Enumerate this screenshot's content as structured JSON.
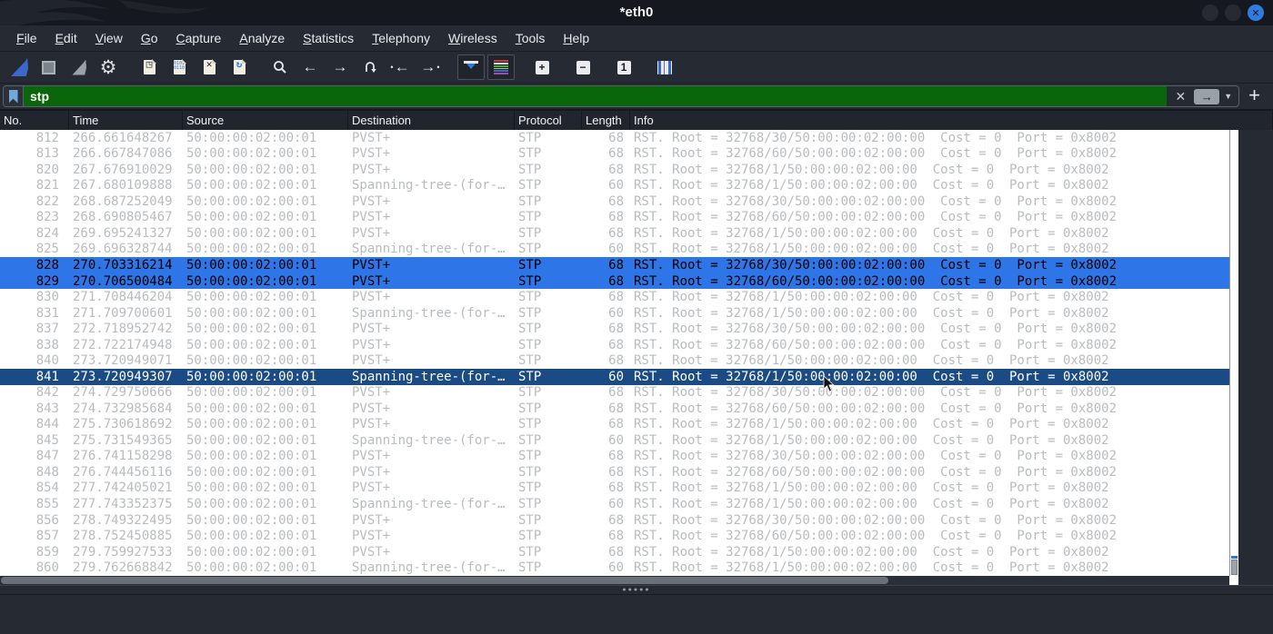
{
  "window": {
    "title": "*eth0"
  },
  "menu": {
    "items": [
      "File",
      "Edit",
      "View",
      "Go",
      "Capture",
      "Analyze",
      "Statistics",
      "Telephony",
      "Wireless",
      "Tools",
      "Help"
    ]
  },
  "toolbar": {
    "buttons": [
      "start-capture",
      "stop-capture",
      "restart-capture",
      "capture-options",
      "open-file",
      "save-file",
      "close-file",
      "reload-file",
      "find-packet",
      "go-back",
      "go-forward",
      "go-to-packet",
      "go-first-packet",
      "go-last-packet",
      "auto-scroll",
      "colorize",
      "zoom-in",
      "zoom-out",
      "normal-size",
      "resize-columns"
    ]
  },
  "filter": {
    "value": "stp"
  },
  "colors": {
    "filter_valid_bg": "#0a660a",
    "selected_row_bg": "#2e76e8",
    "focused_row_bg": "#1b4b84",
    "close_button": "#2f7ce0",
    "row_text": "#b9bcbf"
  },
  "packet_list": {
    "columns": [
      "No.",
      "Time",
      "Source",
      "Destination",
      "Protocol",
      "Length",
      "Info"
    ],
    "packets": [
      {
        "no": "812",
        "time": "266.661648267",
        "source": "50:00:00:02:00:01",
        "destination": "PVST+",
        "protocol": "STP",
        "length": "68",
        "info": "RST. Root = 32768/30/50:00:00:02:00:00  Cost = 0  Port = 0x8002",
        "state": "normal"
      },
      {
        "no": "813",
        "time": "266.667847086",
        "source": "50:00:00:02:00:01",
        "destination": "PVST+",
        "protocol": "STP",
        "length": "68",
        "info": "RST. Root = 32768/60/50:00:00:02:00:00  Cost = 0  Port = 0x8002",
        "state": "normal"
      },
      {
        "no": "820",
        "time": "267.676910029",
        "source": "50:00:00:02:00:01",
        "destination": "PVST+",
        "protocol": "STP",
        "length": "68",
        "info": "RST. Root = 32768/1/50:00:00:02:00:00  Cost = 0  Port = 0x8002",
        "state": "normal"
      },
      {
        "no": "821",
        "time": "267.680109888",
        "source": "50:00:00:02:00:01",
        "destination": "Spanning-tree-(for-…",
        "protocol": "STP",
        "length": "60",
        "info": "RST. Root = 32768/1/50:00:00:02:00:00  Cost = 0  Port = 0x8002",
        "state": "normal"
      },
      {
        "no": "822",
        "time": "268.687252049",
        "source": "50:00:00:02:00:01",
        "destination": "PVST+",
        "protocol": "STP",
        "length": "68",
        "info": "RST. Root = 32768/30/50:00:00:02:00:00  Cost = 0  Port = 0x8002",
        "state": "normal"
      },
      {
        "no": "823",
        "time": "268.690805467",
        "source": "50:00:00:02:00:01",
        "destination": "PVST+",
        "protocol": "STP",
        "length": "68",
        "info": "RST. Root = 32768/60/50:00:00:02:00:00  Cost = 0  Port = 0x8002",
        "state": "normal"
      },
      {
        "no": "824",
        "time": "269.695241327",
        "source": "50:00:00:02:00:01",
        "destination": "PVST+",
        "protocol": "STP",
        "length": "68",
        "info": "RST. Root = 32768/1/50:00:00:02:00:00  Cost = 0  Port = 0x8002",
        "state": "normal"
      },
      {
        "no": "825",
        "time": "269.696328744",
        "source": "50:00:00:02:00:01",
        "destination": "Spanning-tree-(for-…",
        "protocol": "STP",
        "length": "60",
        "info": "RST. Root = 32768/1/50:00:00:02:00:00  Cost = 0  Port = 0x8002",
        "state": "normal"
      },
      {
        "no": "828",
        "time": "270.703316214",
        "source": "50:00:00:02:00:01",
        "destination": "PVST+",
        "protocol": "STP",
        "length": "68",
        "info": "RST. Root = 32768/30/50:00:00:02:00:00  Cost = 0  Port = 0x8002",
        "state": "selected"
      },
      {
        "no": "829",
        "time": "270.706500484",
        "source": "50:00:00:02:00:01",
        "destination": "PVST+",
        "protocol": "STP",
        "length": "68",
        "info": "RST. Root = 32768/60/50:00:00:02:00:00  Cost = 0  Port = 0x8002",
        "state": "selected"
      },
      {
        "no": "830",
        "time": "271.708446204",
        "source": "50:00:00:02:00:01",
        "destination": "PVST+",
        "protocol": "STP",
        "length": "68",
        "info": "RST. Root = 32768/1/50:00:00:02:00:00  Cost = 0  Port = 0x8002",
        "state": "normal"
      },
      {
        "no": "831",
        "time": "271.709700601",
        "source": "50:00:00:02:00:01",
        "destination": "Spanning-tree-(for-…",
        "protocol": "STP",
        "length": "60",
        "info": "RST. Root = 32768/1/50:00:00:02:00:00  Cost = 0  Port = 0x8002",
        "state": "normal"
      },
      {
        "no": "837",
        "time": "272.718952742",
        "source": "50:00:00:02:00:01",
        "destination": "PVST+",
        "protocol": "STP",
        "length": "68",
        "info": "RST. Root = 32768/30/50:00:00:02:00:00  Cost = 0  Port = 0x8002",
        "state": "normal"
      },
      {
        "no": "838",
        "time": "272.722174948",
        "source": "50:00:00:02:00:01",
        "destination": "PVST+",
        "protocol": "STP",
        "length": "68",
        "info": "RST. Root = 32768/60/50:00:00:02:00:00  Cost = 0  Port = 0x8002",
        "state": "normal"
      },
      {
        "no": "840",
        "time": "273.720949071",
        "source": "50:00:00:02:00:01",
        "destination": "PVST+",
        "protocol": "STP",
        "length": "68",
        "info": "RST. Root = 32768/1/50:00:00:02:00:00  Cost = 0  Port = 0x8002",
        "state": "normal"
      },
      {
        "no": "841",
        "time": "273.720949307",
        "source": "50:00:00:02:00:01",
        "destination": "Spanning-tree-(for-…",
        "protocol": "STP",
        "length": "60",
        "info": "RST. Root = 32768/1/50:00:00:02:00:00  Cost = 0  Port = 0x8002",
        "state": "focused"
      },
      {
        "no": "842",
        "time": "274.729750666",
        "source": "50:00:00:02:00:01",
        "destination": "PVST+",
        "protocol": "STP",
        "length": "68",
        "info": "RST. Root = 32768/30/50:00:00:02:00:00  Cost = 0  Port = 0x8002",
        "state": "normal"
      },
      {
        "no": "843",
        "time": "274.732985684",
        "source": "50:00:00:02:00:01",
        "destination": "PVST+",
        "protocol": "STP",
        "length": "68",
        "info": "RST. Root = 32768/60/50:00:00:02:00:00  Cost = 0  Port = 0x8002",
        "state": "normal"
      },
      {
        "no": "844",
        "time": "275.730618692",
        "source": "50:00:00:02:00:01",
        "destination": "PVST+",
        "protocol": "STP",
        "length": "68",
        "info": "RST. Root = 32768/1/50:00:00:02:00:00  Cost = 0  Port = 0x8002",
        "state": "normal"
      },
      {
        "no": "845",
        "time": "275.731549365",
        "source": "50:00:00:02:00:01",
        "destination": "Spanning-tree-(for-…",
        "protocol": "STP",
        "length": "60",
        "info": "RST. Root = 32768/1/50:00:00:02:00:00  Cost = 0  Port = 0x8002",
        "state": "normal"
      },
      {
        "no": "847",
        "time": "276.741158298",
        "source": "50:00:00:02:00:01",
        "destination": "PVST+",
        "protocol": "STP",
        "length": "68",
        "info": "RST. Root = 32768/30/50:00:00:02:00:00  Cost = 0  Port = 0x8002",
        "state": "normal"
      },
      {
        "no": "848",
        "time": "276.744456116",
        "source": "50:00:00:02:00:01",
        "destination": "PVST+",
        "protocol": "STP",
        "length": "68",
        "info": "RST. Root = 32768/60/50:00:00:02:00:00  Cost = 0  Port = 0x8002",
        "state": "normal"
      },
      {
        "no": "854",
        "time": "277.742405021",
        "source": "50:00:00:02:00:01",
        "destination": "PVST+",
        "protocol": "STP",
        "length": "68",
        "info": "RST. Root = 32768/1/50:00:00:02:00:00  Cost = 0  Port = 0x8002",
        "state": "normal"
      },
      {
        "no": "855",
        "time": "277.743352375",
        "source": "50:00:00:02:00:01",
        "destination": "Spanning-tree-(for-…",
        "protocol": "STP",
        "length": "60",
        "info": "RST. Root = 32768/1/50:00:00:02:00:00  Cost = 0  Port = 0x8002",
        "state": "normal"
      },
      {
        "no": "856",
        "time": "278.749322495",
        "source": "50:00:00:02:00:01",
        "destination": "PVST+",
        "protocol": "STP",
        "length": "68",
        "info": "RST. Root = 32768/30/50:00:00:02:00:00  Cost = 0  Port = 0x8002",
        "state": "normal"
      },
      {
        "no": "857",
        "time": "278.752450885",
        "source": "50:00:00:02:00:01",
        "destination": "PVST+",
        "protocol": "STP",
        "length": "68",
        "info": "RST. Root = 32768/60/50:00:00:02:00:00  Cost = 0  Port = 0x8002",
        "state": "normal"
      },
      {
        "no": "859",
        "time": "279.759927533",
        "source": "50:00:00:02:00:01",
        "destination": "PVST+",
        "protocol": "STP",
        "length": "68",
        "info": "RST. Root = 32768/1/50:00:00:02:00:00  Cost = 0  Port = 0x8002",
        "state": "normal"
      },
      {
        "no": "860",
        "time": "279.762668842",
        "source": "50:00:00:02:00:01",
        "destination": "Spanning-tree-(for-…",
        "protocol": "STP",
        "length": "60",
        "info": "RST. Root = 32768/1/50:00:00:02:00:00  Cost = 0  Port = 0x8002",
        "state": "normal"
      }
    ]
  }
}
